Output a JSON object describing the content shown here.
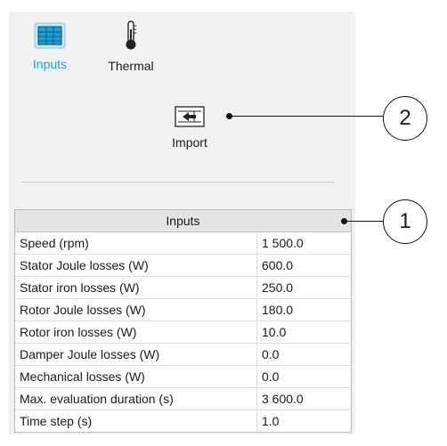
{
  "toolbar": {
    "inputs_label": "Inputs",
    "thermal_label": "Thermal",
    "import_label": "Import"
  },
  "colors": {
    "accent": "#1e9fd6"
  },
  "icons": {
    "inputs": "table-grid-icon",
    "thermal": "thermometer-icon",
    "import": "import-arrow-icon"
  },
  "table": {
    "title": "Inputs",
    "rows": [
      {
        "name": "Speed (rpm)",
        "value": "1 500.0"
      },
      {
        "name": "Stator Joule losses (W)",
        "value": "600.0"
      },
      {
        "name": "Stator iron losses (W)",
        "value": "250.0"
      },
      {
        "name": "Rotor Joule losses (W)",
        "value": "180.0"
      },
      {
        "name": "Rotor iron losses (W)",
        "value": "10.0"
      },
      {
        "name": "Damper Joule losses (W)",
        "value": "0.0"
      },
      {
        "name": "Mechanical losses (W)",
        "value": "0.0"
      },
      {
        "name": "Max. evaluation duration (s)",
        "value": "3 600.0"
      },
      {
        "name": "Time step (s)",
        "value": "1.0"
      }
    ]
  },
  "callouts": [
    "1",
    "2"
  ]
}
